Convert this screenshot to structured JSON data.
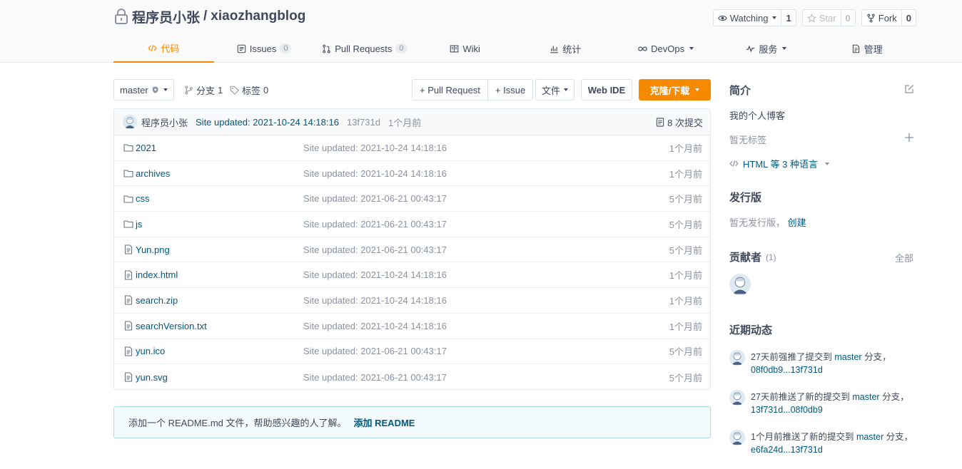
{
  "header": {
    "owner": "程序员小张",
    "separator": "/",
    "repo": "xiaozhangblog",
    "buttons": {
      "watch_label": "Watching",
      "watch_count": "1",
      "star_label": "Star",
      "star_count": "0",
      "fork_label": "Fork",
      "fork_count": "0"
    }
  },
  "tabs": [
    {
      "label": "代码",
      "icon": "code-icon",
      "active": true
    },
    {
      "label": "Issues",
      "icon": "issues-icon",
      "badge": "0"
    },
    {
      "label": "Pull Requests",
      "icon": "pull-request-icon",
      "badge": "0"
    },
    {
      "label": "Wiki",
      "icon": "wiki-icon"
    },
    {
      "label": "统计",
      "icon": "stats-icon"
    },
    {
      "label": "DevOps",
      "icon": "devops-icon",
      "dropdown": true
    },
    {
      "label": "服务",
      "icon": "service-icon",
      "dropdown": true
    },
    {
      "label": "管理",
      "icon": "manage-icon"
    }
  ],
  "toolbar": {
    "branch": "master",
    "branches_label": "分支",
    "branches_count": "1",
    "tags_label": "标签",
    "tags_count": "0",
    "pull_request_btn": "+ Pull Request",
    "issue_btn": "+ Issue",
    "file_btn": "文件",
    "webide_btn": "Web IDE",
    "clone_btn": "克隆/下载"
  },
  "latest_commit": {
    "author": "程序员小张",
    "message": "Site updated: 2021-10-24 14:18:16",
    "sha": "13f731d",
    "time": "1个月前",
    "commits_count": "8 次提交"
  },
  "files": [
    {
      "name": "2021",
      "type": "folder",
      "message": "Site updated: 2021-10-24 14:18:16",
      "time": "1个月前"
    },
    {
      "name": "archives",
      "type": "folder",
      "message": "Site updated: 2021-10-24 14:18:16",
      "time": "1个月前"
    },
    {
      "name": "css",
      "type": "folder",
      "message": "Site updated: 2021-06-21 00:43:17",
      "time": "5个月前"
    },
    {
      "name": "js",
      "type": "folder",
      "message": "Site updated: 2021-06-21 00:43:17",
      "time": "5个月前"
    },
    {
      "name": "Yun.png",
      "type": "file",
      "message": "Site updated: 2021-06-21 00:43:17",
      "time": "5个月前"
    },
    {
      "name": "index.html",
      "type": "file",
      "message": "Site updated: 2021-10-24 14:18:16",
      "time": "1个月前"
    },
    {
      "name": "search.zip",
      "type": "file",
      "message": "Site updated: 2021-10-24 14:18:16",
      "time": "1个月前"
    },
    {
      "name": "searchVersion.txt",
      "type": "file",
      "message": "Site updated: 2021-10-24 14:18:16",
      "time": "1个月前"
    },
    {
      "name": "yun.ico",
      "type": "file",
      "message": "Site updated: 2021-06-21 00:43:17",
      "time": "5个月前"
    },
    {
      "name": "yun.svg",
      "type": "file",
      "message": "Site updated: 2021-06-21 00:43:17",
      "time": "5个月前"
    }
  ],
  "readme": {
    "text": "添加一个 README.md 文件，帮助感兴趣的人了解。",
    "link": "添加 README"
  },
  "sidebar": {
    "intro_title": "简介",
    "intro_text": "我的个人博客",
    "no_tags": "暂无标签",
    "languages": "HTML 等 3 种语言",
    "release_title": "发行版",
    "no_release": "暂无发行版，",
    "create_release": "创建",
    "contributors_title": "贡献者",
    "contributors_count": "(1)",
    "all_label": "全部",
    "activity_title": "近期动态",
    "activities": [
      {
        "pre": "27天前强推了提交到 ",
        "branch": "master",
        "mid": " 分支，",
        "commits": "08f0db9...13f731d"
      },
      {
        "pre": "27天前推送了新的提交到 ",
        "branch": "master",
        "mid": " 分支，",
        "commits": "13f731d...08f0db9"
      },
      {
        "pre": "1个月前推送了新的提交到 ",
        "branch": "master",
        "mid": " 分支，",
        "commits": "e6fa24d...13f731d"
      }
    ]
  },
  "colors": {
    "accent": "#f58a00",
    "link": "#005980",
    "text": "#40485b",
    "muted": "#8c92a4"
  }
}
